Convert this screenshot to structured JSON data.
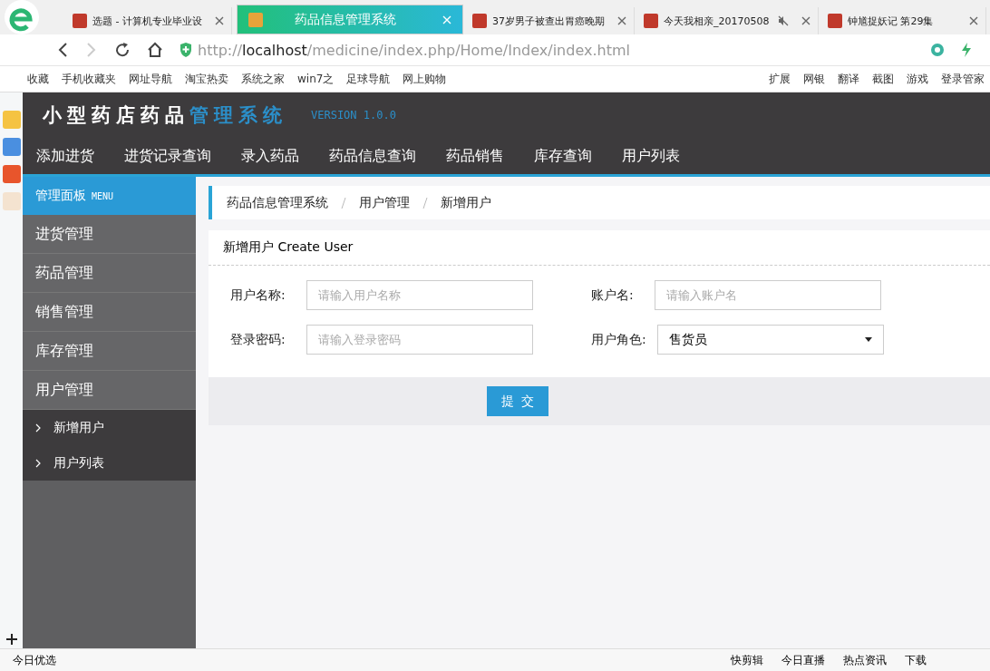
{
  "browser": {
    "tabs": [
      {
        "title": "选题 - 计算机专业毕业设",
        "selected": false,
        "muted": false
      },
      {
        "title": "药品信息管理系统",
        "selected": true,
        "muted": false
      },
      {
        "title": "37岁男子被查出胃癌晚期",
        "selected": false,
        "muted": false
      },
      {
        "title": "今天我相亲_20170508",
        "selected": false,
        "muted": true
      },
      {
        "title": "钟馗捉妖记 第29集",
        "selected": false,
        "muted": false
      }
    ],
    "url": {
      "scheme": "http://",
      "host": "localhost",
      "path": "/medicine/index.php/Home/Index/index.html"
    },
    "bookmarks": [
      "收藏",
      "手机收藏夹",
      "网址导航",
      "淘宝热卖",
      "系统之家",
      "win7之",
      "足球导航",
      "网上购物"
    ],
    "tools": [
      "扩展",
      "网银",
      "翻译",
      "截图",
      "游戏",
      "登录管家"
    ]
  },
  "app": {
    "title": "小型药店药品",
    "title_accent": "管理系统",
    "version": "VERSION 1.0.0",
    "nav": [
      "添加进货",
      "进货记录查询",
      "录入药品",
      "药品信息查询",
      "药品销售",
      "库存查询",
      "用户列表"
    ],
    "sidebar": {
      "title": "管理面板",
      "title_en": "MENU",
      "items": [
        {
          "label": "进货管理"
        },
        {
          "label": "药品管理"
        },
        {
          "label": "销售管理"
        },
        {
          "label": "库存管理"
        },
        {
          "label": "用户管理",
          "children": [
            {
              "label": "新增用户"
            },
            {
              "label": "用户列表"
            }
          ]
        }
      ]
    },
    "breadcrumb": [
      "药品信息管理系统",
      "用户管理",
      "新增用户"
    ],
    "panel_title": "新增用户 Create User",
    "fields": [
      {
        "kind": "input",
        "label": "用户名称:",
        "placeholder": "请输入用户名称"
      },
      {
        "kind": "input",
        "label": "账户名:",
        "placeholder": "请输入账户名"
      },
      {
        "kind": "input",
        "label": "登录密码:",
        "placeholder": "请输入登录密码"
      },
      {
        "kind": "select",
        "label": "用户角色:",
        "value": "售货员"
      }
    ],
    "submit": "提  交"
  },
  "status_bar": {
    "left": "今日优选",
    "right": [
      "快剪辑",
      "今日直播",
      "热点资讯",
      "下载"
    ]
  }
}
